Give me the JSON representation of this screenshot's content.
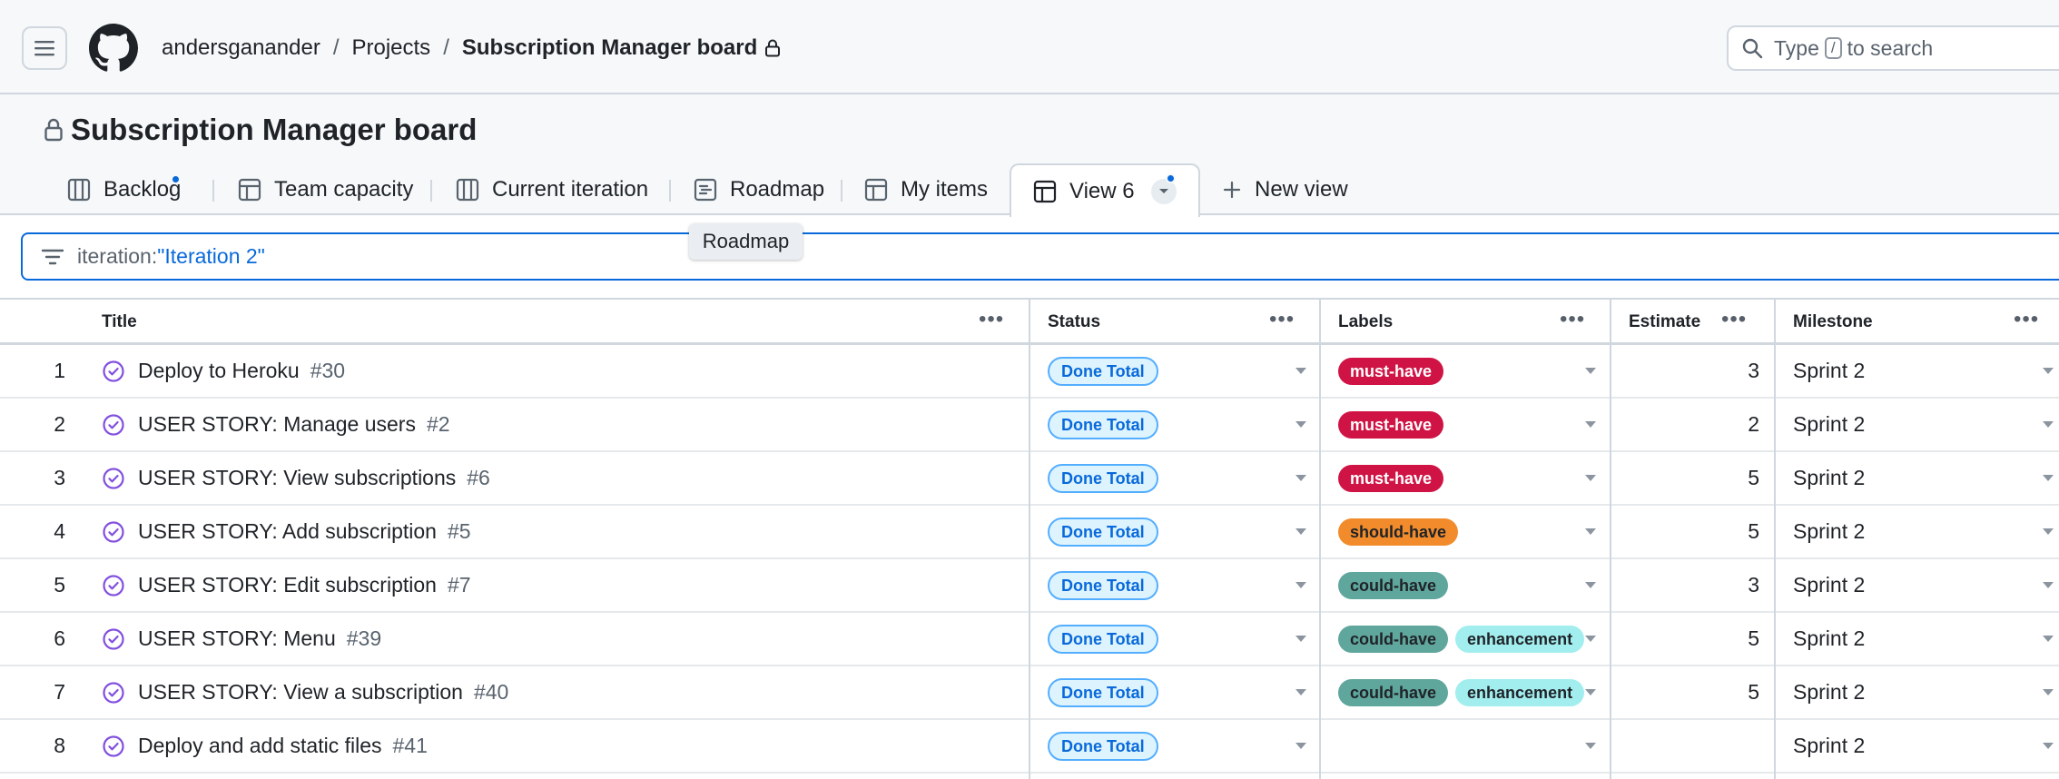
{
  "header": {
    "breadcrumb": {
      "owner": "andersganander",
      "separator": "/",
      "projects": "Projects",
      "current": "Subscription Manager board"
    },
    "search": {
      "prefix": "Type",
      "key": "/",
      "suffix": "to search"
    }
  },
  "project": {
    "title": "Subscription Manager board",
    "tabs": [
      {
        "label": "Backlog",
        "icon": "board-icon",
        "unsaved_changes": true
      },
      {
        "label": "Team capacity",
        "icon": "table-icon"
      },
      {
        "label": "Current iteration",
        "icon": "board-icon"
      },
      {
        "label": "Roadmap",
        "icon": "roadmap-icon"
      },
      {
        "label": "My items",
        "icon": "table-icon"
      },
      {
        "label": "View 6",
        "icon": "table-icon",
        "active": true,
        "unsaved_changes": true
      }
    ],
    "new_view_label": "New view",
    "tooltip": "Roadmap"
  },
  "filter": {
    "key": "iteration:",
    "value": "\"Iteration 2\""
  },
  "table": {
    "columns": [
      "Title",
      "Status",
      "Labels",
      "Estimate",
      "Milestone"
    ],
    "more_glyph": "•••",
    "rows": [
      {
        "n": "1",
        "title": "Deploy to Heroku",
        "num": "#30",
        "status": "Done Total",
        "labels": [
          "must-have"
        ],
        "estimate": "3",
        "milestone": "Sprint 2"
      },
      {
        "n": "2",
        "title": "USER STORY: Manage users",
        "num": "#2",
        "status": "Done Total",
        "labels": [
          "must-have"
        ],
        "estimate": "2",
        "milestone": "Sprint 2"
      },
      {
        "n": "3",
        "title": "USER STORY: View subscriptions",
        "num": "#6",
        "status": "Done Total",
        "labels": [
          "must-have"
        ],
        "estimate": "5",
        "milestone": "Sprint 2"
      },
      {
        "n": "4",
        "title": "USER STORY: Add subscription",
        "num": "#5",
        "status": "Done Total",
        "labels": [
          "should-have"
        ],
        "estimate": "5",
        "milestone": "Sprint 2"
      },
      {
        "n": "5",
        "title": "USER STORY: Edit subscription",
        "num": "#7",
        "status": "Done Total",
        "labels": [
          "could-have"
        ],
        "estimate": "3",
        "milestone": "Sprint 2"
      },
      {
        "n": "6",
        "title": "USER STORY: Menu",
        "num": "#39",
        "status": "Done Total",
        "labels": [
          "could-have",
          "enhancement"
        ],
        "estimate": "5",
        "milestone": "Sprint 2"
      },
      {
        "n": "7",
        "title": "USER STORY: View a subscription",
        "num": "#40",
        "status": "Done Total",
        "labels": [
          "could-have",
          "enhancement"
        ],
        "estimate": "5",
        "milestone": "Sprint 2"
      },
      {
        "n": "8",
        "title": "Deploy and add static files",
        "num": "#41",
        "status": "Done Total",
        "labels": [],
        "estimate": "",
        "milestone": "Sprint 2"
      }
    ]
  },
  "colors": {
    "accent": "#0969da",
    "closed_issue": "#8250df",
    "label_must_have": "#cf1445",
    "label_should_have": "#f18b2b",
    "label_could_have": "#5fa69c",
    "label_enhancement": "#a2eeef"
  }
}
